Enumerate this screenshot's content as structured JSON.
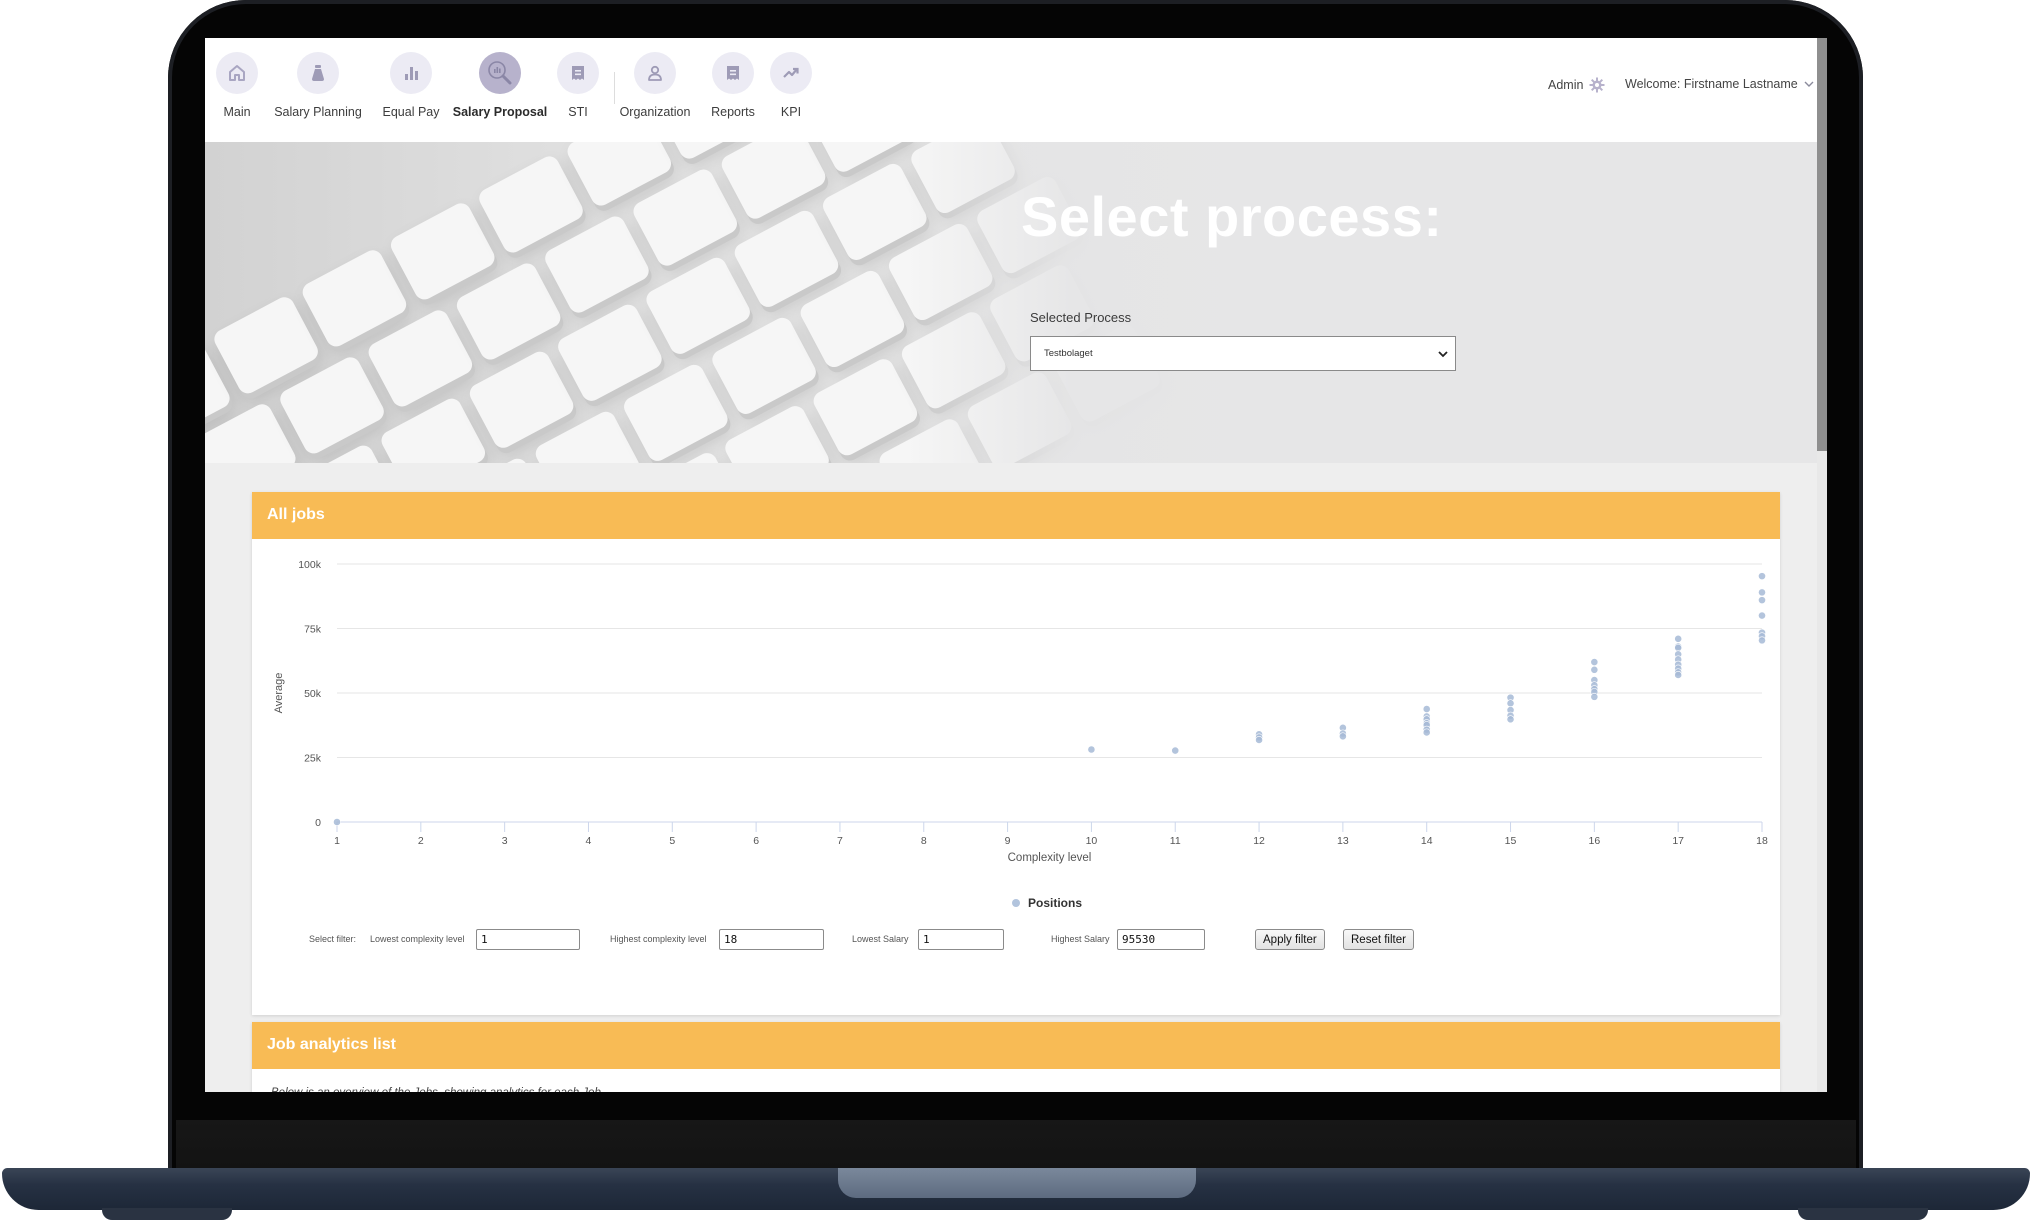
{
  "nav": {
    "items": [
      {
        "label": "Main",
        "icon": "home-icon",
        "active": false
      },
      {
        "label": "Salary Planning",
        "icon": "money-bag-icon",
        "active": false
      },
      {
        "label": "Equal Pay",
        "icon": "bar-chart-icon",
        "active": false
      },
      {
        "label": "Salary Proposal",
        "icon": "magnifier-chart-icon",
        "active": true
      },
      {
        "label": "STI",
        "icon": "receipt-icon",
        "active": false
      },
      {
        "label": "Organization",
        "icon": "person-icon",
        "active": false
      },
      {
        "label": "Reports",
        "icon": "receipt-icon",
        "active": false
      },
      {
        "label": "KPI",
        "icon": "trend-up-icon",
        "active": false
      }
    ],
    "admin_label": "Admin",
    "welcome_label": "Welcome: Firstname Lastname"
  },
  "hero": {
    "title": "Select process:",
    "select_label": "Selected Process",
    "selected_value": "Testbolaget"
  },
  "all_jobs": {
    "title": "All jobs",
    "filters": {
      "select_label": "Select filter:",
      "lowest_complexity_label": "Lowest complexity level",
      "lowest_complexity_value": "1",
      "highest_complexity_label": "Highest complexity level",
      "highest_complexity_value": "18",
      "lowest_salary_label": "Lowest Salary",
      "lowest_salary_value": "1",
      "highest_salary_label": "Highest Salary",
      "highest_salary_value": "95530",
      "apply_label": "Apply filter",
      "reset_label": "Reset filter"
    }
  },
  "job_analytics": {
    "title": "Job analytics list",
    "intro": "Below is an overview of the Jobs, showing analytics for each Job"
  },
  "colors": {
    "accent": "#f8bb55",
    "point": "#a6bad6",
    "nav_circle": "#ecebf4",
    "nav_circle_active": "#b7b2cc"
  },
  "chart_data": {
    "type": "scatter",
    "title": "",
    "xlabel": "Complexity level",
    "ylabel": "Average",
    "xlim": [
      1,
      18
    ],
    "ylim": [
      0,
      100000
    ],
    "x_ticks": [
      "1",
      "2",
      "3",
      "4",
      "5",
      "6",
      "7",
      "8",
      "9",
      "10",
      "11",
      "12",
      "13",
      "14",
      "15",
      "16",
      "17",
      "18"
    ],
    "y_ticks": [
      {
        "value": 0,
        "label": "0"
      },
      {
        "value": 25000,
        "label": "25k"
      },
      {
        "value": 50000,
        "label": "50k"
      },
      {
        "value": 75000,
        "label": "75k"
      },
      {
        "value": 100000,
        "label": "100k"
      }
    ],
    "grid": true,
    "legend_position": "bottom-center",
    "series": [
      {
        "name": "Positions",
        "points": [
          [
            1,
            0
          ],
          [
            10,
            28100
          ],
          [
            11,
            27700
          ],
          [
            12,
            34000
          ],
          [
            12,
            32800
          ],
          [
            12,
            31800
          ],
          [
            13,
            36500
          ],
          [
            13,
            34300
          ],
          [
            13,
            33200
          ],
          [
            14,
            43800
          ],
          [
            14,
            40900
          ],
          [
            14,
            39800
          ],
          [
            14,
            38300
          ],
          [
            14,
            37600
          ],
          [
            14,
            35800
          ],
          [
            14,
            34700
          ],
          [
            15,
            48200
          ],
          [
            15,
            46000
          ],
          [
            15,
            43400
          ],
          [
            15,
            41200
          ],
          [
            15,
            39800
          ],
          [
            16,
            62000
          ],
          [
            16,
            59000
          ],
          [
            16,
            55000
          ],
          [
            16,
            53000
          ],
          [
            16,
            51500
          ],
          [
            16,
            50400
          ],
          [
            16,
            48500
          ],
          [
            17,
            71000
          ],
          [
            17,
            68000
          ],
          [
            17,
            67500
          ],
          [
            17,
            65000
          ],
          [
            17,
            63000
          ],
          [
            17,
            61000
          ],
          [
            17,
            59500
          ],
          [
            17,
            58000
          ],
          [
            17,
            57000
          ],
          [
            18,
            95300
          ],
          [
            18,
            89000
          ],
          [
            18,
            86000
          ],
          [
            18,
            80000
          ],
          [
            18,
            73400
          ],
          [
            18,
            72000
          ],
          [
            18,
            70400
          ]
        ]
      }
    ]
  }
}
